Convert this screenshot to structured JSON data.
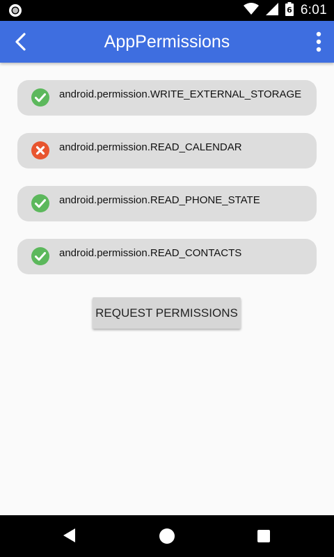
{
  "status_bar": {
    "time": "6:01",
    "battery_level": "6"
  },
  "app_bar": {
    "title": "AppPermissions"
  },
  "permissions": [
    {
      "name": "android.permission.WRITE_EXTERNAL_STORAGE",
      "granted": true
    },
    {
      "name": "android.permission.READ_CALENDAR",
      "granted": false
    },
    {
      "name": "android.permission.READ_PHONE_STATE",
      "granted": true
    },
    {
      "name": "android.permission.READ_CONTACTS",
      "granted": true
    }
  ],
  "actions": {
    "request_label": "REQUEST PERMISSIONS"
  },
  "colors": {
    "app_bar": "#3e6ee0",
    "granted": "#5cb85c",
    "denied": "#e8552f",
    "item_bg": "#dddddd"
  }
}
